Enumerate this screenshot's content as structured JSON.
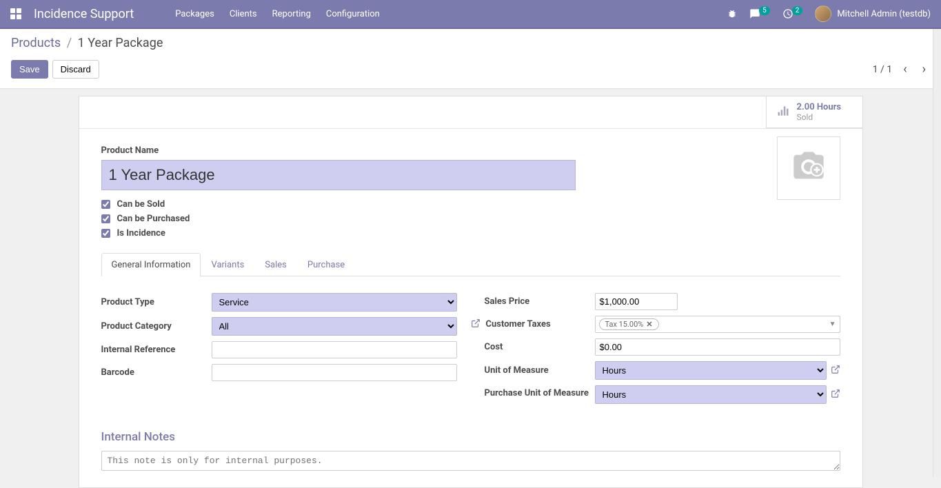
{
  "navbar": {
    "brand": "Incidence Support",
    "menu": [
      "Packages",
      "Clients",
      "Reporting",
      "Configuration"
    ],
    "messages_badge": "5",
    "activities_badge": "2",
    "user": "Mitchell Admin (testdb)"
  },
  "breadcrumb": {
    "root": "Products",
    "current": "1 Year Package"
  },
  "actions": {
    "save": "Save",
    "discard": "Discard"
  },
  "pager": {
    "text": "1 / 1"
  },
  "stat": {
    "value": "2.00 Hours",
    "label": "Sold"
  },
  "form": {
    "product_name_label": "Product Name",
    "product_name": "1 Year Package",
    "can_be_sold": "Can be Sold",
    "can_be_purchased": "Can be Purchased",
    "is_incidence": "Is Incidence"
  },
  "tabs": [
    "General Information",
    "Variants",
    "Sales",
    "Purchase"
  ],
  "fields": {
    "product_type_label": "Product Type",
    "product_type": "Service",
    "product_category_label": "Product Category",
    "product_category": "All",
    "internal_reference_label": "Internal Reference",
    "internal_reference": "",
    "barcode_label": "Barcode",
    "barcode": "",
    "sales_price_label": "Sales Price",
    "sales_price": "$1,000.00",
    "customer_taxes_label": "Customer Taxes",
    "customer_tax_tag": "Tax 15.00%",
    "cost_label": "Cost",
    "cost": "$0.00",
    "uom_label": "Unit of Measure",
    "uom": "Hours",
    "puom_label": "Purchase Unit of Measure",
    "puom": "Hours"
  },
  "notes": {
    "title": "Internal Notes",
    "placeholder": "This note is only for internal purposes."
  }
}
